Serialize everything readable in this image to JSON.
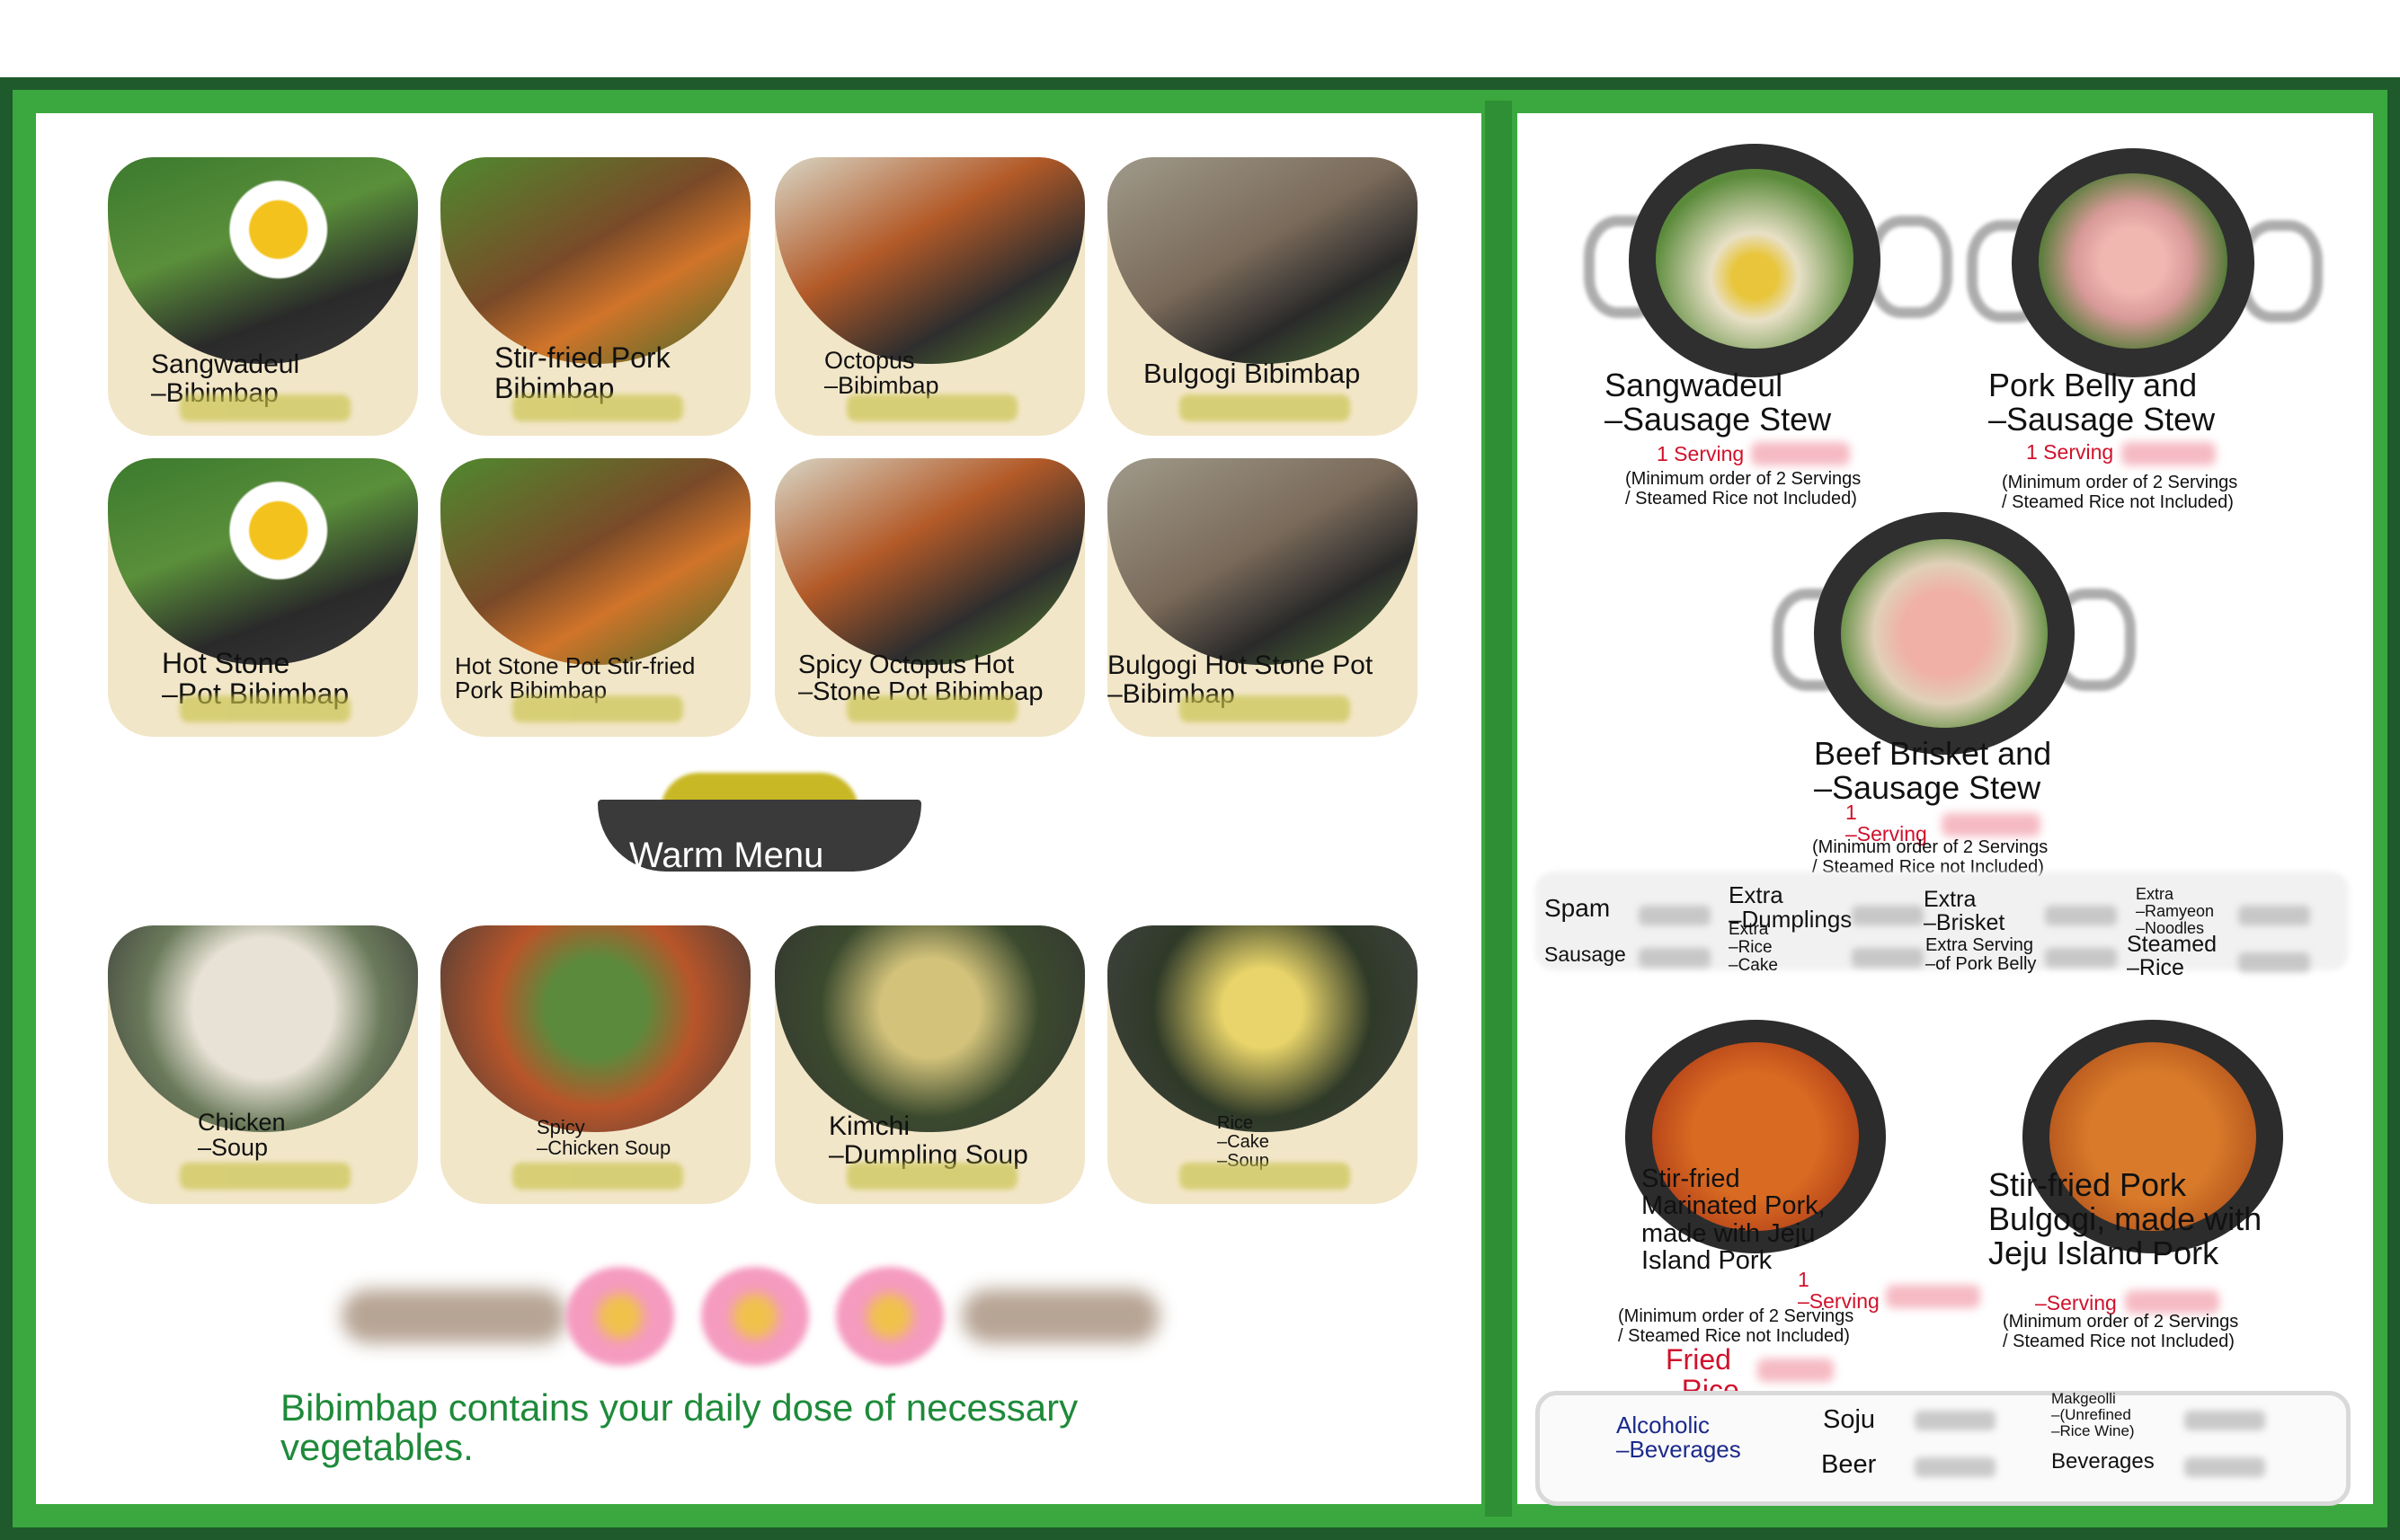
{
  "left_menu": {
    "dishes_row1": [
      {
        "name": "Sangwadeul\n–Bibimbap"
      },
      {
        "name": "Stir-fried Pork\nBibimbap"
      },
      {
        "name": "Octopus\n–Bibimbap"
      },
      {
        "name": "Bulgogi Bibimbap"
      }
    ],
    "dishes_row2": [
      {
        "name": "Hot Stone\n–Pot Bibimbap"
      },
      {
        "name": "Hot Stone Pot Stir-fried\nPork Bibimbap"
      },
      {
        "name": "Spicy Octopus Hot\n–Stone Pot Bibimbap"
      },
      {
        "name": "Bulgogi Hot Stone Pot\n–Bibimbap"
      }
    ],
    "warm_menu_label": "Warm Menu",
    "dishes_row3": [
      {
        "name": "Chicken\n–Soup"
      },
      {
        "name": "Spicy\n–Chicken Soup"
      },
      {
        "name": "Kimchi\n–Dumpling Soup"
      },
      {
        "name": "Rice\n–Cake\n–Soup"
      }
    ],
    "tagline": "Bibimbap contains your daily dose of necessary vegetables."
  },
  "right_menu": {
    "stews": [
      {
        "name": "Sangwadeul\n–Sausage Stew",
        "serving": "1 Serving",
        "note": "(Minimum order of 2 Servings\n/ Steamed Rice not Included)"
      },
      {
        "name": "Pork Belly and\n–Sausage Stew",
        "serving": "1 Serving",
        "note": "(Minimum order of 2 Servings\n/ Steamed Rice not Included)"
      },
      {
        "name": "Beef Brisket and\n–Sausage Stew",
        "serving": "1\n–Serving",
        "note": "(Minimum order of 2 Servings\n/ Steamed Rice not Included)"
      }
    ],
    "extras": {
      "spam": "Spam",
      "sausage": "Sausage",
      "extra_dumplings": "Extra\n–Dumplings",
      "extra_rice_cake": "Extra\n–Rice\n–Cake",
      "extra_brisket": "Extra\n–Brisket",
      "extra_pork_belly": "Extra Serving\n–of Pork Belly",
      "extra_ramyeon": "Extra\n–Ramyeon\n–Noodles",
      "steamed_rice": "Steamed\n–Rice"
    },
    "stir_fried": [
      {
        "name": "Stir-fried\nMarinated Pork,\nmade with Jeju\nIsland Pork",
        "serving": "1\n–Serving",
        "note": "(Minimum order of 2 Servings\n/ Steamed Rice not Included)"
      },
      {
        "name": "Stir-fried Pork\nBulgogi, made with\nJeju Island Pork",
        "serving": "–Serving",
        "note": "(Minimum order of 2 Servings\n/ Steamed Rice not Included)"
      }
    ],
    "fried_rice": "Fried\n–Rice",
    "beverages": {
      "alcoholic_label": "Alcoholic\n–Beverages",
      "soju": "Soju",
      "beer": "Beer",
      "makgeolli": "Makgeolli\n–(Unrefined\n–Rice Wine)",
      "beverages": "Beverages"
    }
  },
  "colors": {
    "frame_dark_green": "#1f5a2c",
    "frame_green": "#3aa83e",
    "tile_beige": "#f2e6c8",
    "price_red": "#d0112b",
    "tagline_green": "#1e8a3a",
    "beverage_blue": "#1b2a8a"
  }
}
